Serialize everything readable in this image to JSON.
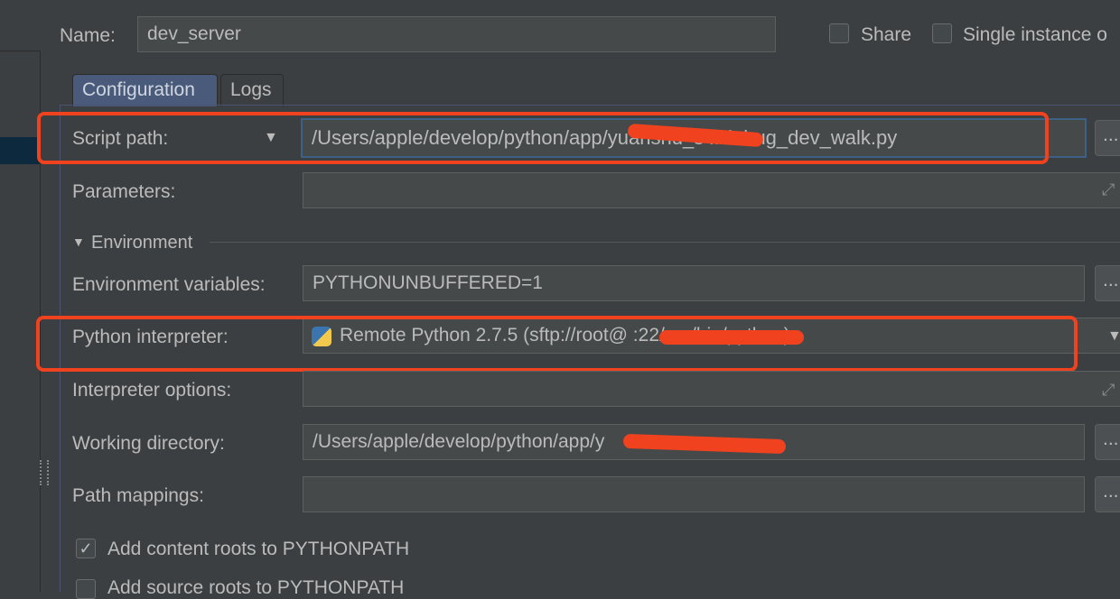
{
  "name": {
    "label": "Name:",
    "value": "dev_server"
  },
  "share": {
    "label": "Share",
    "checked": false
  },
  "single_instance": {
    "label": "Single instance o",
    "checked": false
  },
  "tabs": [
    {
      "label": "Configuration",
      "active": true
    },
    {
      "label": "Logs",
      "active": false
    }
  ],
  "script_path": {
    "label": "Script path:",
    "value": "/Users/apple/develop/python/app/yuanshu_server/debug_dev_walk.py",
    "shown": "/Users/apple/develop/python/app/yuanshu_s    r/debug_dev_walk.py"
  },
  "parameters": {
    "label": "Parameters:",
    "value": ""
  },
  "environment": {
    "label": "Environment"
  },
  "env_vars": {
    "label": "Environment variables:",
    "value": "PYTHONUNBUFFERED=1"
  },
  "interpreter": {
    "label": "Python interpreter:",
    "value": "Remote Python 2.7.5 (sftp://root@                    :22/usr/bin/python)"
  },
  "interpreter_options": {
    "label": "Interpreter options:",
    "value": ""
  },
  "working_dir": {
    "label": "Working directory:",
    "value": "/Users/apple/develop/python/app/y            "
  },
  "path_mappings": {
    "label": "Path mappings:",
    "value": ""
  },
  "add_content_roots": {
    "label": "Add content roots to PYTHONPATH",
    "checked": true
  },
  "add_source_roots": {
    "label": "Add source roots to PYTHONPATH",
    "checked": true
  },
  "browse": "...",
  "colors": {
    "annotation": "#f0421f",
    "accent": "#4a6a9a"
  }
}
